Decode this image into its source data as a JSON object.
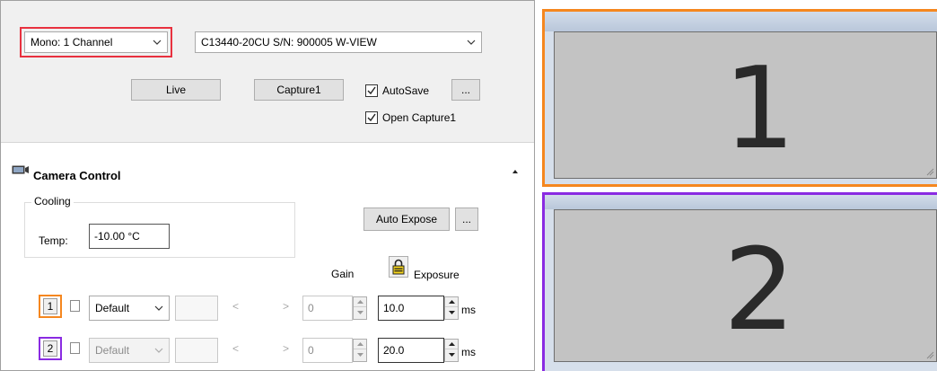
{
  "top": {
    "channel_mode": "Mono: 1 Channel",
    "camera_select": "C13440-20CU S/N: 900005 W-VIEW",
    "live_label": "Live",
    "capture_label": "Capture1",
    "autosave_label": "AutoSave",
    "autosave_checked": true,
    "more_label": "...",
    "open_capture_label": "Open Capture1",
    "open_capture_checked": true
  },
  "camera_control": {
    "title": "Camera Control",
    "cooling_label": "Cooling",
    "temp_label": "Temp:",
    "temp_value": "-10.00 °C",
    "auto_expose_label": "Auto Expose",
    "more_label": "...",
    "gain_label": "Gain",
    "exposure_label": "Exposure",
    "lock_icon": "lock-icon",
    "channels": [
      {
        "number": "1",
        "preset": "Default",
        "lt": "<",
        "gt": ">",
        "gain": "0",
        "exposure": "10.0",
        "unit": "ms",
        "color": "#f5871f"
      },
      {
        "number": "2",
        "preset": "Default",
        "lt": "<",
        "gt": ">",
        "gain": "0",
        "exposure": "20.0",
        "unit": "ms",
        "color": "#8a2be2"
      }
    ]
  },
  "views": [
    {
      "label": "1",
      "color": "#f5871f"
    },
    {
      "label": "2",
      "color": "#8a2be2"
    }
  ],
  "colors": {
    "highlight_red": "#e8313f",
    "channel1": "#f5871f",
    "channel2": "#8a2be2"
  }
}
